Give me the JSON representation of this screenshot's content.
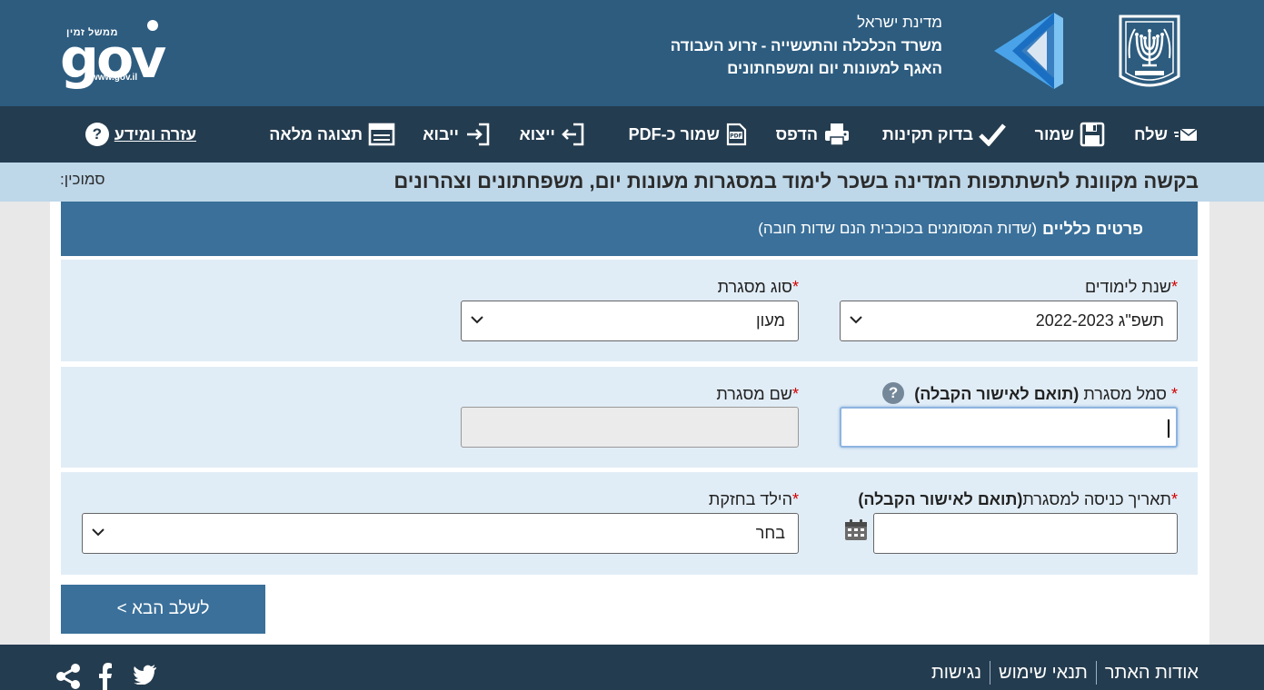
{
  "header": {
    "state": "מדינת ישראל",
    "ministry": "משרד הכלכלה והתעשייה - זרוע העבודה",
    "department": "האגף למעונות יום ומשפחתונים",
    "gov_top": "ממשל זמין",
    "gov_word": "gov",
    "gov_url": "www.gov.il"
  },
  "toolbar": {
    "send": "שלח",
    "save": "שמור",
    "validate": "בדוק תקינות",
    "print": "הדפס",
    "save_pdf": "שמור כ-PDF",
    "export": "ייצוא",
    "import": "ייבוא",
    "full_view": "תצוגה מלאה",
    "help": "עזרה ומידע",
    "help_symbol": "?"
  },
  "title_bar": {
    "title": "בקשה מקוונת להשתתפות המדינה בשכר לימוד במסגרות מעונות יום, משפחתונים וצהרונים",
    "reference_label": "סמוכין:"
  },
  "section": {
    "title": "פרטים כלליים",
    "note": "(שדות המסומנים בכוכבית הנם שדות חובה)"
  },
  "form": {
    "required_mark": "*",
    "school_year_label": "שנת לימודים",
    "school_year_value": "תשפ\"ג 2022-2023",
    "framework_type_label": "סוג מסגרת",
    "framework_type_value": "מעון",
    "framework_code_label": "סמל מסגרת",
    "framework_code_bold": "(תואם לאישור הקבלה)",
    "framework_code_value": "",
    "framework_name_label": "שם מסגרת",
    "framework_name_value": "",
    "entry_date_label": "תאריך כניסה למסגרת",
    "entry_date_bold": "(תואם לאישור הקבלה)",
    "entry_date_value": "",
    "custody_label": "הילד בחזקת",
    "custody_value": "בחר",
    "help_symbol": "?"
  },
  "next_button": "לשלב הבא >",
  "footer": {
    "links": [
      "אודות האתר",
      "תנאי שימוש",
      "נגישות"
    ]
  },
  "icons": {
    "send": "envelope-icon",
    "save": "floppy-icon",
    "validate": "checkmark-icon",
    "print": "printer-icon",
    "pdf": "pdf-icon",
    "export": "export-icon",
    "import": "import-icon",
    "full_view": "window-icon",
    "help": "question-icon",
    "calendar": "calendar-icon",
    "share": "share-icon",
    "facebook": "facebook-icon",
    "twitter": "twitter-icon"
  },
  "colors": {
    "header_bg": "#2d5c7f",
    "toolbar_bg": "#243c4f",
    "title_bar_bg": "#bed7e9",
    "section_bg": "#3a709a",
    "row_bg": "#e1edf6",
    "required": "#d40000"
  }
}
